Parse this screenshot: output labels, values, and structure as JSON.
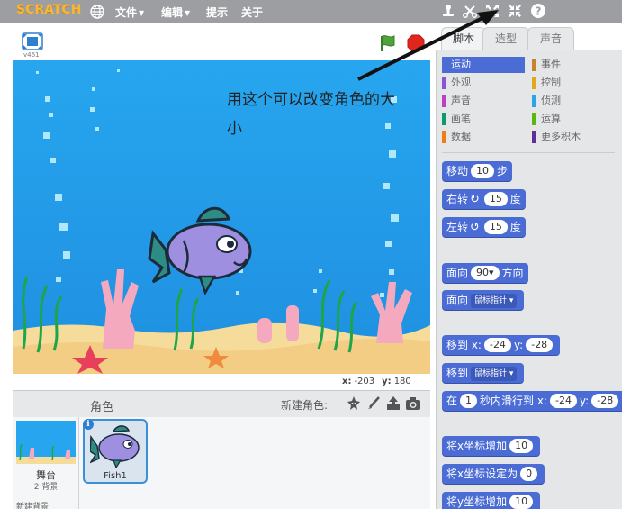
{
  "app": {
    "logo_text": "SCRATCH",
    "menu": [
      {
        "label": "文件",
        "has_caret": true
      },
      {
        "label": "编辑",
        "has_caret": true
      },
      {
        "label": "提示",
        "has_caret": false
      },
      {
        "label": "关于",
        "has_caret": false
      }
    ],
    "toolbar_icons": [
      "duplicate-stamp-icon",
      "cut-scissors-icon",
      "grow-icon",
      "shrink-icon",
      "help-icon"
    ]
  },
  "stage": {
    "version": "v461",
    "annotation_text": "用这个可以改变角色的大小",
    "mouse_x_label": "x:",
    "mouse_x": "-203",
    "mouse_y_label": "y:",
    "mouse_y": "180"
  },
  "sprites": {
    "header_label": "角色",
    "new_sprite_label": "新建角色:",
    "stage_label": "舞台",
    "stage_backdrops": "2 背景",
    "new_backdrop_label": "新建背景",
    "items": [
      {
        "name": "Fish1",
        "selected": true
      }
    ]
  },
  "palette": {
    "tabs": [
      {
        "label": "脚本",
        "active": true
      },
      {
        "label": "造型",
        "active": false
      },
      {
        "label": "声音",
        "active": false
      }
    ],
    "categories": [
      {
        "label": "运动",
        "color": "#4a6cd4",
        "selected": true
      },
      {
        "label": "事件",
        "color": "#c88330",
        "selected": false
      },
      {
        "label": "外观",
        "color": "#8a55d7",
        "selected": false
      },
      {
        "label": "控制",
        "color": "#e1a91a",
        "selected": false
      },
      {
        "label": "声音",
        "color": "#bb42c3",
        "selected": false
      },
      {
        "label": "侦测",
        "color": "#2ca5e2",
        "selected": false
      },
      {
        "label": "画笔",
        "color": "#0e9a6c",
        "selected": false
      },
      {
        "label": "运算",
        "color": "#5cb712",
        "selected": false
      },
      {
        "label": "数据",
        "color": "#ee7d16",
        "selected": false
      },
      {
        "label": "更多积木",
        "color": "#632d99",
        "selected": false
      }
    ],
    "blocks": {
      "move": {
        "pre": "移动",
        "value": "10",
        "post": "步"
      },
      "turn_right": {
        "pre": "右转",
        "value": "15",
        "post": "度"
      },
      "turn_left": {
        "pre": "左转",
        "value": "15",
        "post": "度"
      },
      "point_dir": {
        "pre": "面向",
        "value": "90▾",
        "post": "方向"
      },
      "point_towards": {
        "pre": "面向",
        "dropdown": "鼠标指针 ▾"
      },
      "goto_xy": {
        "pre": "移到 x:",
        "x": "-24",
        "mid": "y:",
        "y": "-28"
      },
      "goto": {
        "pre": "移到",
        "dropdown": "鼠标指针 ▾"
      },
      "glide": {
        "pre": "在",
        "secs": "1",
        "mid": "秒内滑行到 x:",
        "x": "-24",
        "mid2": "y:",
        "y": "-28"
      },
      "change_x": {
        "pre": "将x坐标增加",
        "value": "10"
      },
      "set_x": {
        "pre": "将x坐标设定为",
        "value": "0"
      },
      "change_y": {
        "pre": "将y坐标增加",
        "value": "10"
      }
    }
  }
}
